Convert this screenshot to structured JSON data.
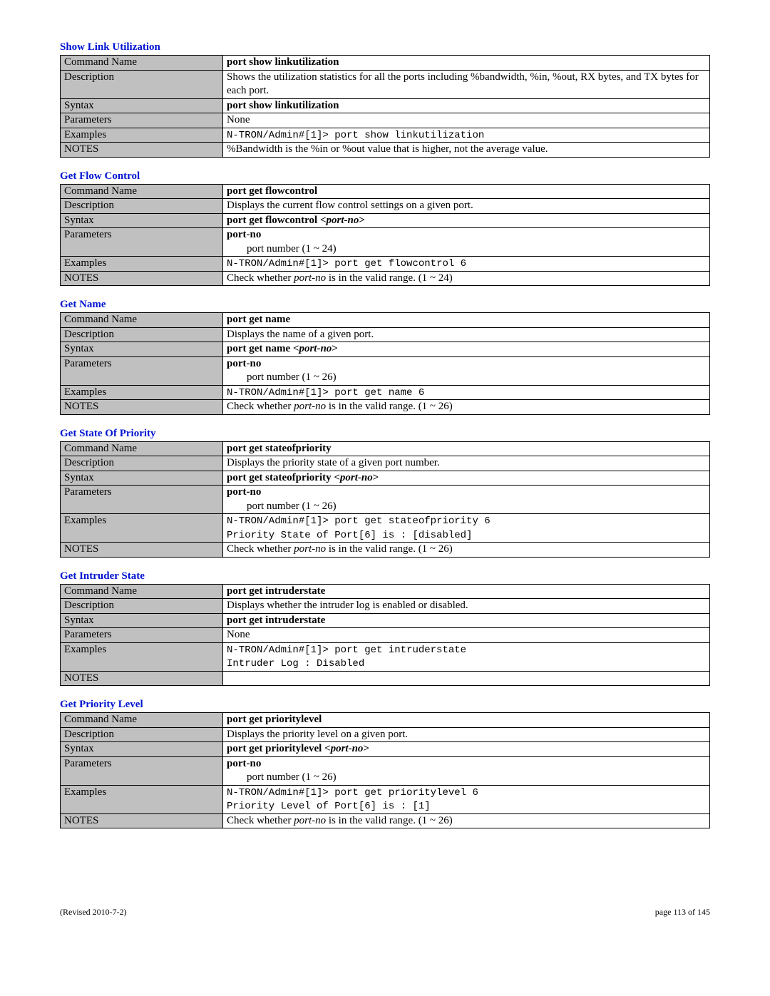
{
  "footer": {
    "left": "(Revised 2010-7-2)",
    "right": "page 113 of 145"
  },
  "row_labels": {
    "command_name": "Command Name",
    "description": "Description",
    "syntax": "Syntax",
    "parameters": "Parameters",
    "examples": "Examples",
    "notes": "NOTES"
  },
  "sections": [
    {
      "title": "Show Link Utilization",
      "command_name": "port show linkutilization",
      "description": "Shows the utilization statistics for all the ports including %bandwidth, %in, %out, RX bytes, and TX bytes for each port.",
      "syntax_bold": "port show linkutilization",
      "syntax_italic": "",
      "parameters_bold": "",
      "parameters_desc": "None",
      "examples": [
        "N-TRON/Admin#[1]> port show linkutilization"
      ],
      "notes_pre": "%Bandwidth is the %in or %out value that is higher, not the average value.",
      "notes_italic": "",
      "notes_post": ""
    },
    {
      "title": "Get Flow Control",
      "command_name": "port get flowcontrol",
      "description": "Displays the current flow control settings on a given port.",
      "syntax_bold": "port get flowcontrol <",
      "syntax_italic": "port-no",
      "syntax_close": ">",
      "parameters_bold": "port-no",
      "parameters_desc": "port number (1 ~ 24)",
      "examples": [
        "N-TRON/Admin#[1]> port get flowcontrol 6"
      ],
      "notes_pre": "Check whether ",
      "notes_italic": "port-no",
      "notes_post": " is in the valid range. (1 ~ 24)"
    },
    {
      "title": "Get Name",
      "command_name": "port get name",
      "description": "Displays the name of a given port.",
      "syntax_bold": "port get name <",
      "syntax_italic": "port-no",
      "syntax_close": ">",
      "parameters_bold": "port-no",
      "parameters_desc": "port number (1 ~ 26)",
      "examples": [
        "N-TRON/Admin#[1]> port get name 6"
      ],
      "notes_pre": "Check whether ",
      "notes_italic": "port-no",
      "notes_post": " is in the valid range. (1 ~ 26)"
    },
    {
      "title": "Get State Of  Priority",
      "command_name": "port get stateofpriority",
      "description": "Displays the priority state of a given port number.",
      "syntax_bold": "port get stateofpriority <",
      "syntax_italic": "port-no",
      "syntax_close": ">",
      "parameters_bold": "port-no",
      "parameters_desc": "port number (1 ~ 26)",
      "examples": [
        "N-TRON/Admin#[1]> port get stateofpriority 6",
        "Priority State of Port[6] is : [disabled]"
      ],
      "notes_pre": "Check whether ",
      "notes_italic": "port-no",
      "notes_post": " is in the valid range. (1 ~ 26)"
    },
    {
      "title": "Get Intruder State",
      "command_name": "port get intruderstate",
      "description": "Displays whether the intruder log is enabled or disabled.",
      "syntax_bold": "port get intruderstate",
      "syntax_italic": "",
      "syntax_close": "",
      "parameters_bold": "",
      "parameters_desc": "None",
      "examples": [
        "N-TRON/Admin#[1]> port get intruderstate",
        "Intruder Log : Disabled"
      ],
      "notes_pre": "",
      "notes_italic": "",
      "notes_post": ""
    },
    {
      "title": "Get Priority Level",
      "command_name": "port get prioritylevel",
      "description": "Displays the priority level on a given port.",
      "syntax_bold": "port get prioritylevel <",
      "syntax_italic": "port-no",
      "syntax_close": ">",
      "parameters_bold": "port-no",
      "parameters_desc": "port number (1 ~ 26)",
      "examples": [
        "N-TRON/Admin#[1]> port get prioritylevel 6",
        "Priority Level of Port[6] is : [1]"
      ],
      "notes_pre": "Check whether ",
      "notes_italic": "port-no",
      "notes_post": " is in the valid range. (1 ~ 26)"
    }
  ]
}
